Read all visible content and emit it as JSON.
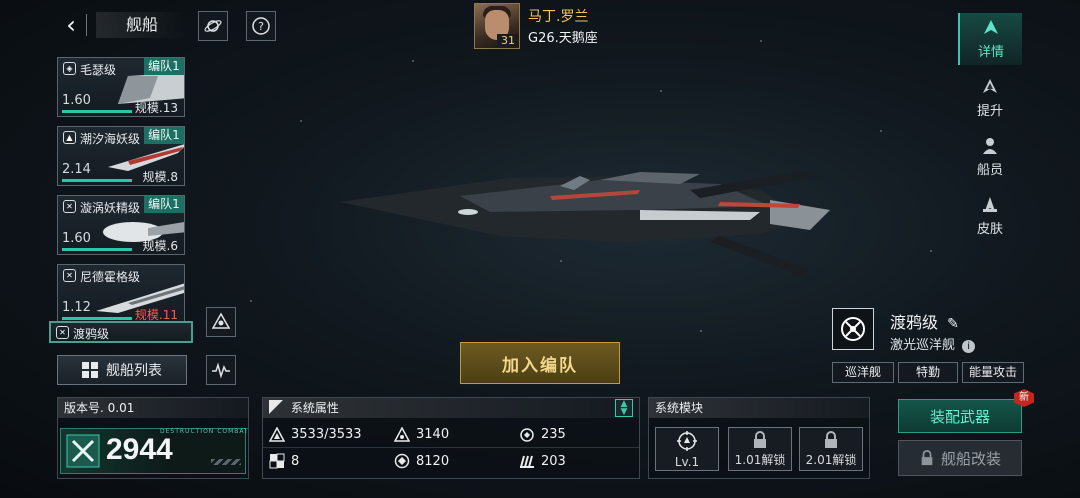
{
  "header": {
    "title": "舰船",
    "back_icon": "back-chevron-icon",
    "planet_icon": "planet-icon",
    "help_icon": "help-icon"
  },
  "commander": {
    "name": "马丁.罗兰",
    "level": "31",
    "system": "G26.天鹅座"
  },
  "ship_list": [
    {
      "class_name": "毛瑟级",
      "fleet_tag": "编队1",
      "rating": "1.60",
      "scale": "规模.13",
      "scale_warning": false
    },
    {
      "class_name": "潮汐海妖级",
      "fleet_tag": "编队1",
      "rating": "2.14",
      "scale": "规模.8",
      "scale_warning": false
    },
    {
      "class_name": "漩涡妖精级",
      "fleet_tag": "编队1",
      "rating": "1.60",
      "scale": "规模.6",
      "scale_warning": false
    },
    {
      "class_name": "尼德霍格级",
      "fleet_tag": "",
      "rating": "1.12",
      "scale": "规模.11",
      "scale_warning": true
    },
    {
      "class_name": "渡鸦级",
      "fleet_tag": "",
      "rating": "",
      "scale": "",
      "scale_warning": false
    }
  ],
  "ship_list_button": "舰船列表",
  "join_fleet_button": "加入编队",
  "tabs": [
    {
      "label": "详情",
      "active": true
    },
    {
      "label": "提升",
      "active": false
    },
    {
      "label": "船员",
      "active": false
    },
    {
      "label": "皮肤",
      "active": false
    }
  ],
  "ship_info": {
    "class_name": "渡鸦级",
    "type": "激光巡洋舰",
    "tags": [
      "巡洋舰",
      "特勤",
      "能量攻击"
    ]
  },
  "version": {
    "label": "版本号. 0.01",
    "power": "2944",
    "power_caption": "DESTRUCTION COMBAT"
  },
  "attributes": {
    "title": "系统属性",
    "items": [
      {
        "icon": "hull-icon",
        "value": "3533/3533"
      },
      {
        "icon": "armor-icon",
        "value": "3140"
      },
      {
        "icon": "shield-icon",
        "value": "235"
      },
      {
        "icon": "speed-icon",
        "value": "8"
      },
      {
        "icon": "energy-icon",
        "value": "8120"
      },
      {
        "icon": "cargo-icon",
        "value": "203"
      }
    ]
  },
  "modules": {
    "title": "系统模块",
    "slots": [
      {
        "label": "Lv.1",
        "locked": false
      },
      {
        "label": "1.01解锁",
        "locked": true
      },
      {
        "label": "2.01解锁",
        "locked": true
      }
    ]
  },
  "actions": {
    "equip_weapon": "装配武器",
    "new_badge": "新",
    "ship_modify": "舰船改装"
  },
  "colors": {
    "accent": "#3fc7a8",
    "gold": "#f2c45a",
    "warning": "#ff5a4a"
  }
}
